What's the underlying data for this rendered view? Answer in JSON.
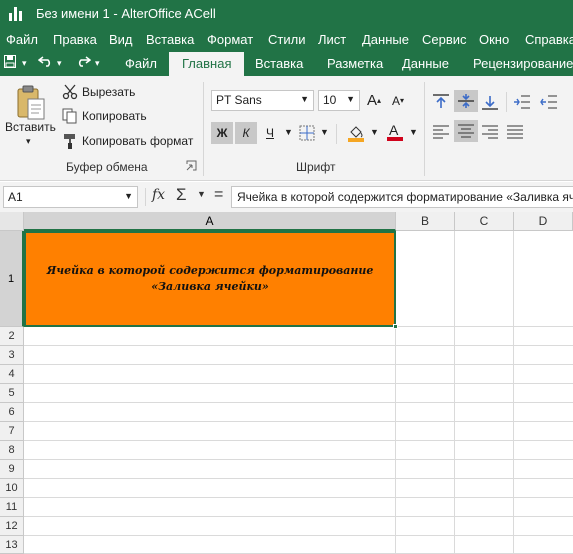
{
  "title": "Без имени 1 - AlterOffice ACell",
  "menu": [
    "Файл",
    "Правка",
    "Вид",
    "Вставка",
    "Формат",
    "Стили",
    "Лист",
    "Данные",
    "Сервис",
    "Окно",
    "Справка"
  ],
  "ribbon_tabs": [
    "Файл",
    "Главная",
    "Вставка",
    "Разметка",
    "Данные",
    "Рецензирование"
  ],
  "active_tab": "Главная",
  "clipboard": {
    "paste": "Вставить",
    "cut": "Вырезать",
    "copy": "Копировать",
    "copy_format": "Копировать формат",
    "group": "Буфер обмена"
  },
  "font": {
    "name": "PT Sans",
    "size": "10",
    "bold": "Ж",
    "italic": "К",
    "underline": "Ч",
    "group": "Шрифт",
    "highlight_color": "#f5a623",
    "text_color": "#d0021b"
  },
  "formula_bar": {
    "name_box": "A1",
    "fx": "fx",
    "sigma": "Σ",
    "equals": "=",
    "content": "Ячейка в которой содержится форматирование «Заливка ячейки»"
  },
  "columns": [
    "A",
    "B",
    "C",
    "D"
  ],
  "rows": [
    "1",
    "2",
    "3",
    "4",
    "5",
    "6",
    "7",
    "8",
    "9",
    "10",
    "11",
    "12",
    "13"
  ],
  "cell_a1": {
    "text": "Ячейка в которой содержится форматирование «Заливка ячейки»",
    "fill_color": "#ff8000"
  },
  "colors": {
    "brand": "#217346"
  }
}
